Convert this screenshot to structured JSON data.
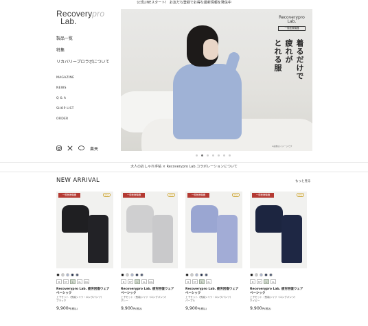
{
  "topbar": {
    "text": "公式LINEスタート！ お友だち登録でお得な最新情報を発信中"
  },
  "logo": {
    "line1": "Recovery",
    "line1b": "pro",
    "line2": "Lab."
  },
  "nav": {
    "items": [
      "製品一覧",
      "特集",
      "リカバリープロラボについて"
    ],
    "en_items": [
      "MAGAZINE",
      "NEWS",
      "Q & A",
      "SHOP LIST",
      "ORDER"
    ]
  },
  "socials": {
    "instagram": "instagram-icon",
    "x": "x-icon",
    "line": "LINE",
    "rakuten": "楽天"
  },
  "hero": {
    "logo_text": "Recoverypro Lab.",
    "logo_tag": "一般医療機器",
    "vertical_text": [
      "着るだけで",
      "疲れが",
      "とれる服"
    ],
    "note": "※画像はイメージです",
    "dots_count": 7,
    "active_dot": 1
  },
  "collab": {
    "text": "大人のおしゃれ手帖 × Recoverypro Lab.コラボレーションについて"
  },
  "new_arrival": {
    "title": "NEW ARRIVAL",
    "more": "もっと見る",
    "products": [
      {
        "badge": "一般医療機器",
        "new": "NEW",
        "shirt_color": "#1f1f22",
        "pants_color": "#222226",
        "swatches": [
          "#111111",
          "#c8c8c8",
          "#a9b3cc",
          "#2a3550",
          "#4f5a72"
        ],
        "sizes": [
          "M",
          "M*",
          "L",
          "XL",
          "XXL"
        ],
        "selected_size": "L",
        "title": "Recoverypro Lab. 疲労回復ウェア",
        "title2": "ベーシック",
        "sub": "上下セット（長袖シャツ・ロングパンツ）",
        "color": "ブラック",
        "price": "9,900",
        "tax": "円(税込)"
      },
      {
        "badge": "一般医療機器",
        "new": "NEW",
        "shirt_color": "#cfcfd0",
        "pants_color": "#c9c9cb",
        "swatches": [
          "#111111",
          "#c8c8c8",
          "#a9b3cc",
          "#2a3550",
          "#4f5a72"
        ],
        "sizes": [
          "M",
          "M*",
          "L",
          "XL",
          "XXL"
        ],
        "selected_size": "L",
        "title": "Recoverypro Lab. 疲労回復ウェア",
        "title2": "ベーシック",
        "sub": "上下セット（長袖シャツ・ロングパンツ）",
        "color": "グレー",
        "price": "9,900",
        "tax": "円(税込)"
      },
      {
        "badge": "一般医療機器",
        "new": "NEW",
        "shirt_color": "#9aa6d2",
        "pants_color": "#a2acd6",
        "swatches": [
          "#111111",
          "#c8c8c8",
          "#a9b3cc",
          "#2a3550",
          "#4f5a72"
        ],
        "sizes": [
          "M",
          "M*",
          "L",
          "XL"
        ],
        "selected_size": "L",
        "title": "Recoverypro Lab. 疲労回復ウェア",
        "title2": "ベーシック",
        "sub": "上下セット（長袖シャツ・ロングパンツ）",
        "color": "パープル",
        "price": "9,900",
        "tax": "円(税込)"
      },
      {
        "badge": "一般医療機器",
        "new": "NEW",
        "shirt_color": "#1c2540",
        "pants_color": "#1e2744",
        "swatches": [
          "#111111",
          "#c8c8c8",
          "#a9b3cc",
          "#2a3550",
          "#4f5a72"
        ],
        "sizes": [
          "M",
          "M*",
          "L",
          "XL"
        ],
        "selected_size": "L",
        "title": "Recoverypro Lab. 疲労回復ウェア",
        "title2": "ベーシック",
        "sub": "上下セット（長袖シャツ・ロングパンツ）",
        "color": "ネイビー",
        "price": "9,900",
        "tax": "円(税込)"
      }
    ]
  }
}
